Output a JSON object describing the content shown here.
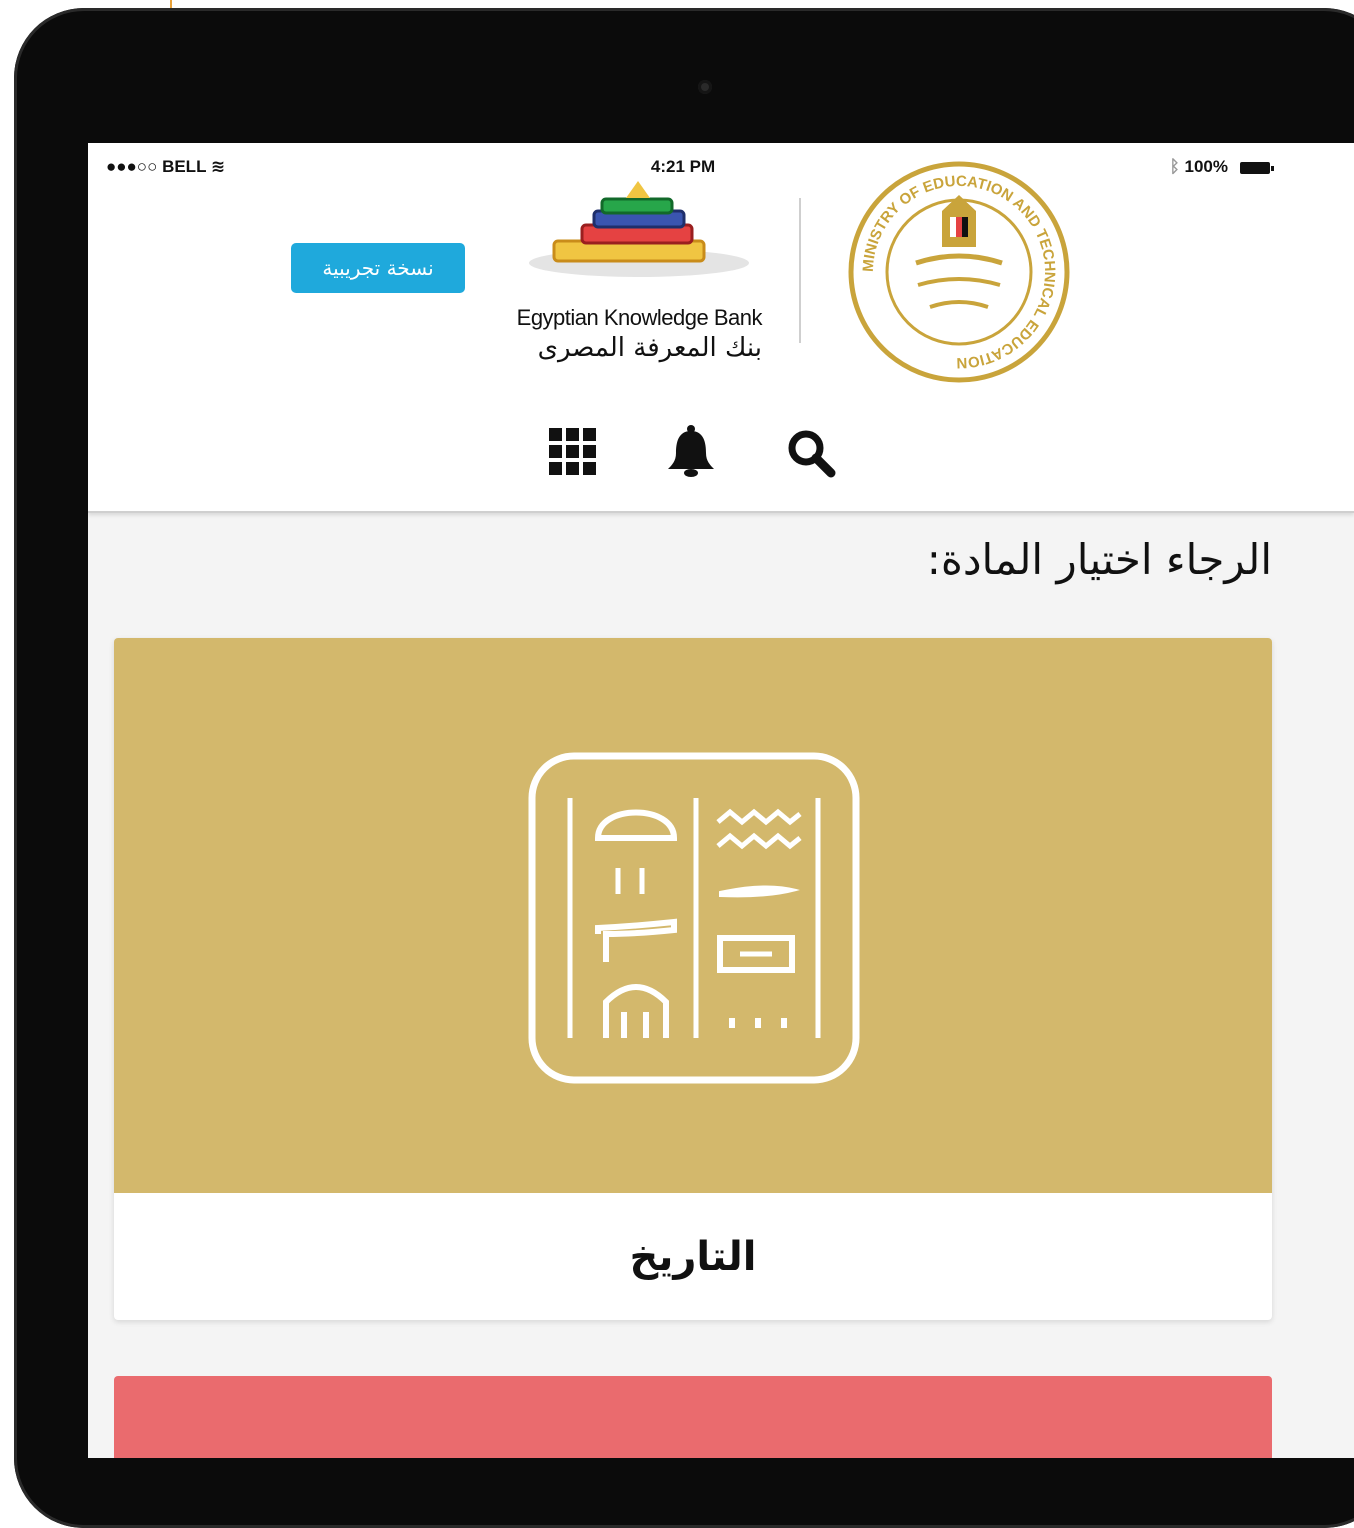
{
  "status_bar": {
    "carrier": "●●●○○ BELL",
    "time": "4:21 PM",
    "battery": "100%"
  },
  "header": {
    "trial_badge": "نسخة تجريبية",
    "logo_en": "Egyptian Knowledge Bank",
    "logo_ar": "بنك المعرفة المصرى",
    "seal_text": "MINISTRY OF EDUCATION AND TECHNICAL EDUCATION",
    "icons": [
      "apps-grid-icon",
      "bell-icon",
      "search-icon"
    ]
  },
  "main": {
    "title": "الرجاء اختيار المادة:",
    "subjects": [
      {
        "label": "التاريخ",
        "color": "#d3b86c",
        "icon": "hieroglyph-icon"
      },
      {
        "label": "",
        "color": "#ea6b6e"
      }
    ]
  },
  "colors": {
    "accent": "#1fa9dc",
    "gold": "#d3b86c",
    "red": "#ea6b6e",
    "seal": "#c9a43b"
  }
}
